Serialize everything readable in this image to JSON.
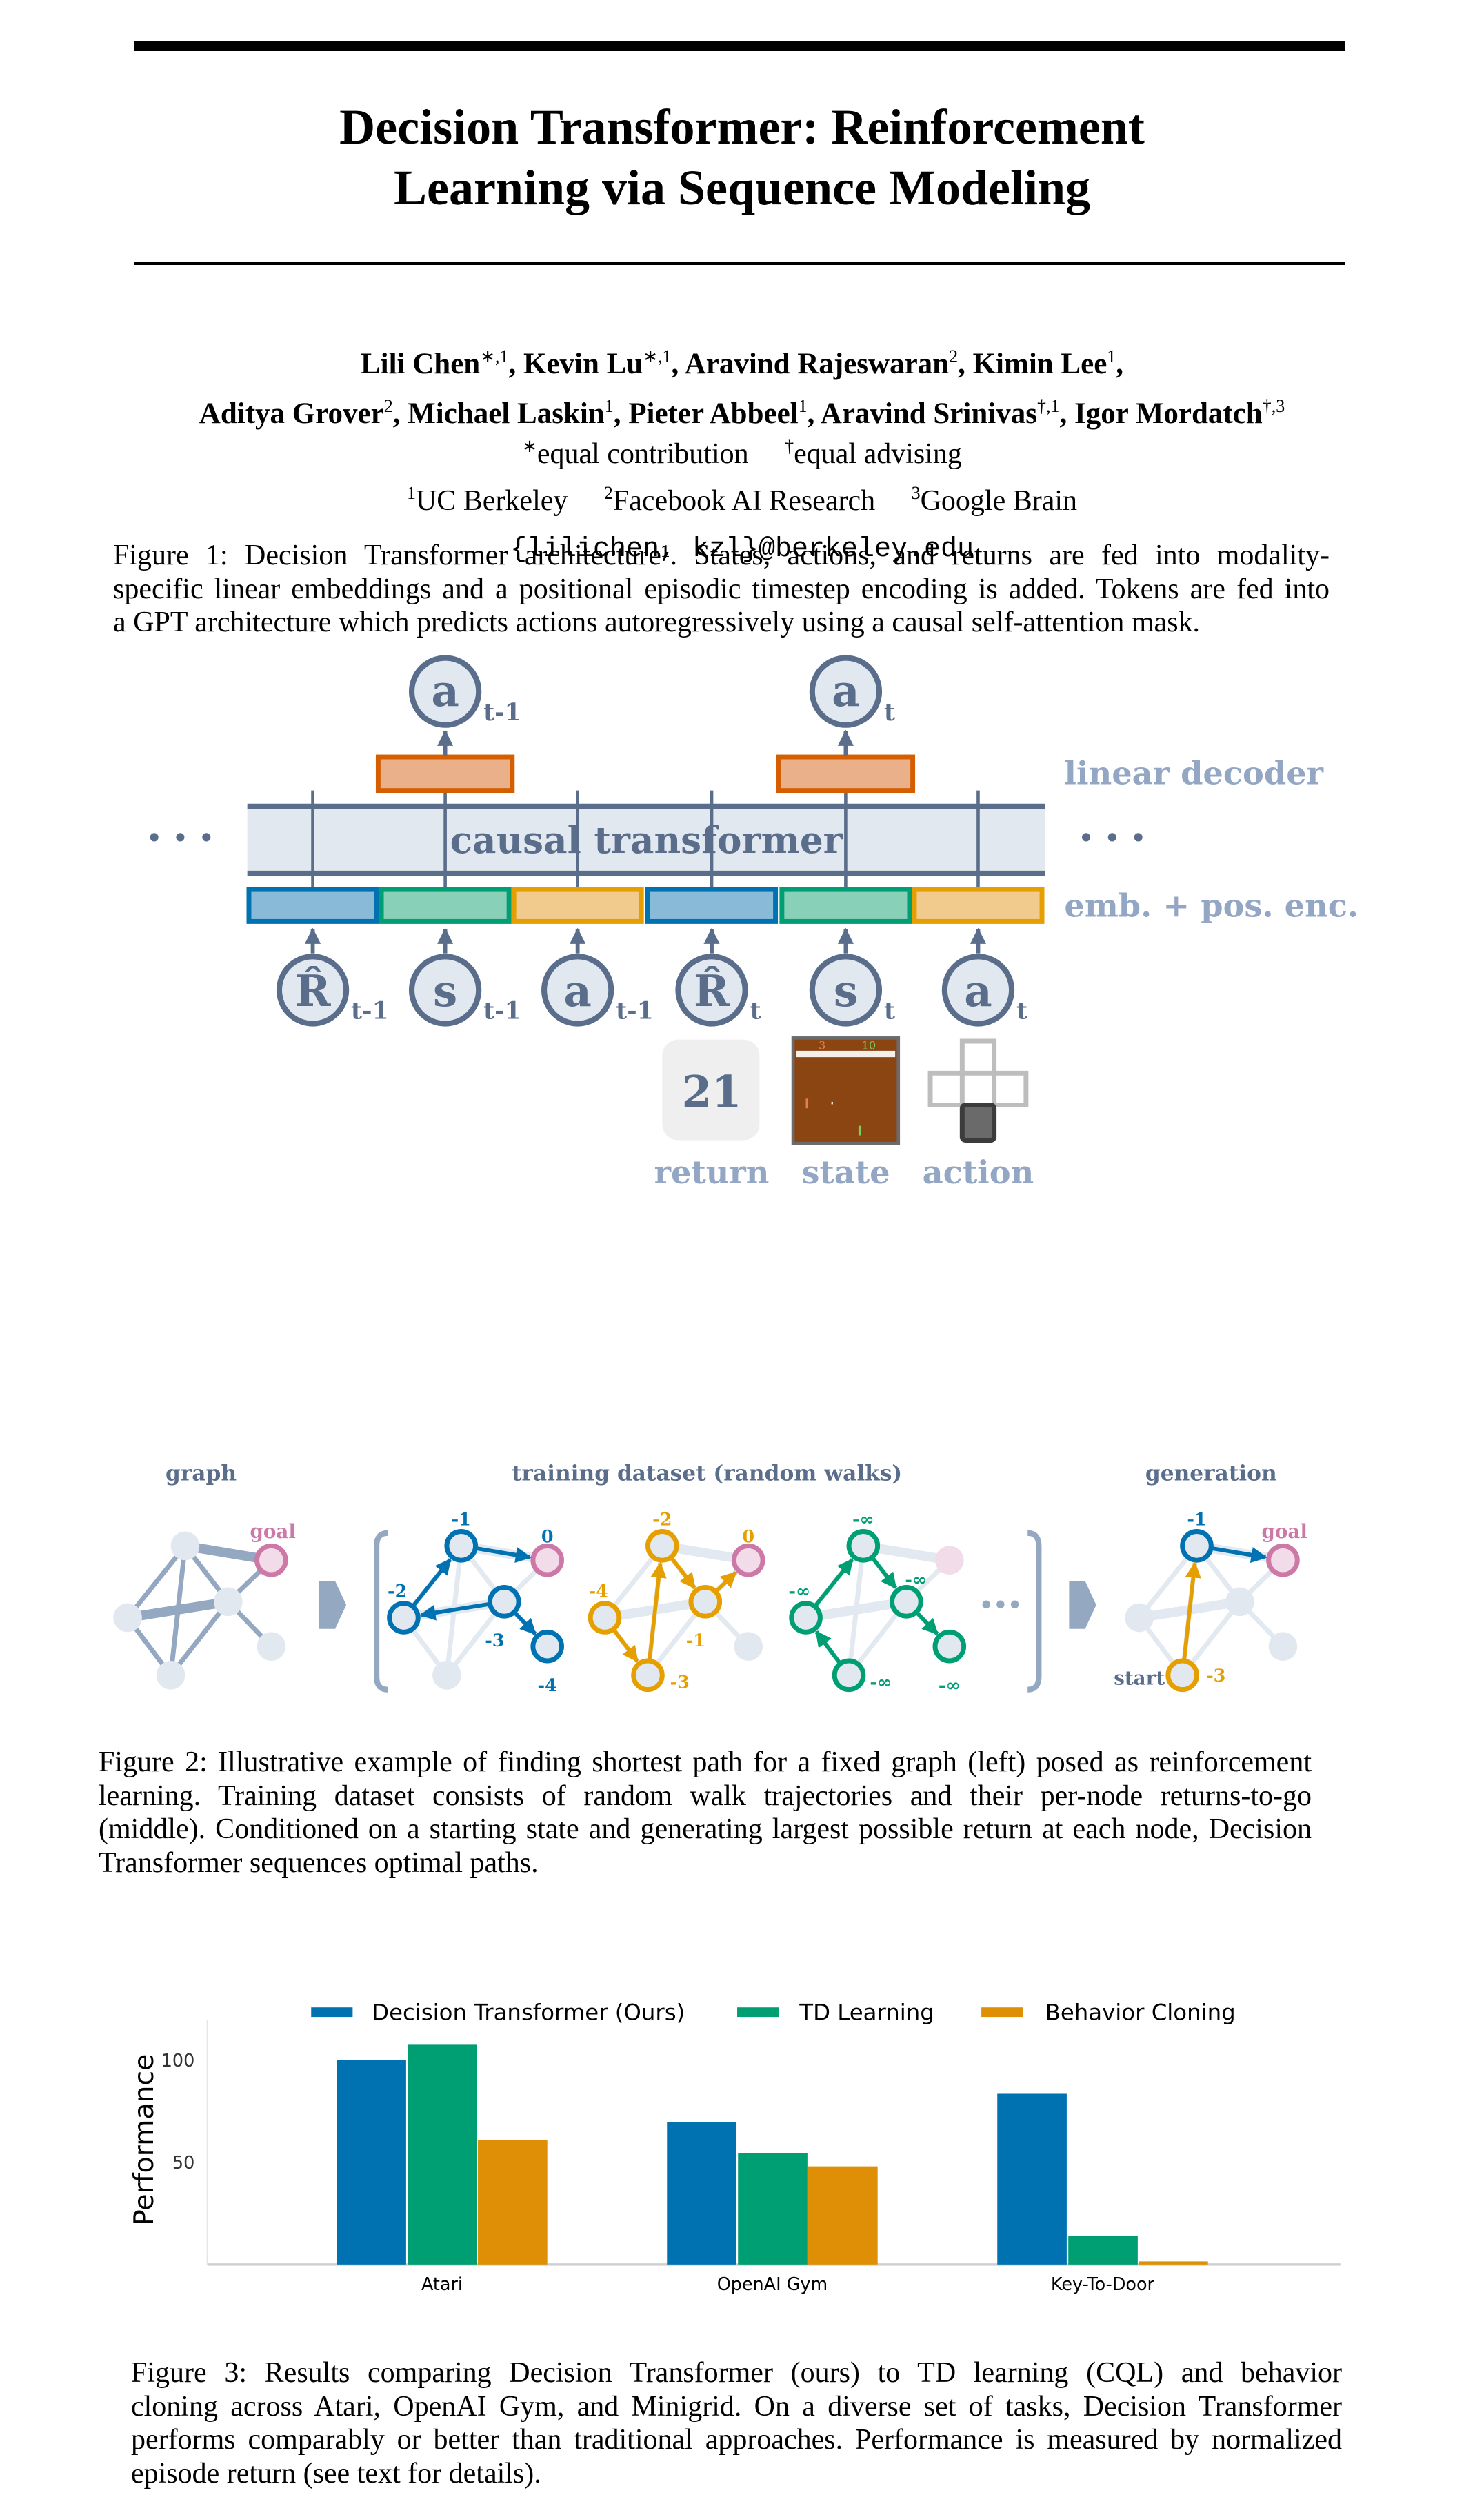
{
  "paper": {
    "title_lines": [
      "Decision Transformer: Reinforcement",
      "Learning via Sequence Modeling"
    ],
    "authors_line1": [
      {
        "name": "Lili Chen",
        "sup": "∗,1",
        "sep": ", "
      },
      {
        "name": "Kevin Lu",
        "sup": "∗,1",
        "sep": ", "
      },
      {
        "name": "Aravind Rajeswaran",
        "sup": "2",
        "sep": ", "
      },
      {
        "name": "Kimin Lee",
        "sup": "1",
        "sep": ","
      }
    ],
    "authors_line2": [
      {
        "name": "Aditya Grover",
        "sup": "2",
        "sep": ", "
      },
      {
        "name": "Michael Laskin",
        "sup": "1",
        "sep": ", "
      },
      {
        "name": "Pieter Abbeel",
        "sup": "1",
        "sep": ", "
      },
      {
        "name": "Aravind Srinivas",
        "sup": "†,1",
        "sep": ", "
      },
      {
        "name": "Igor Mordatch",
        "sup": "†,3",
        "sep": ""
      }
    ],
    "notes": [
      {
        "sup": "∗",
        "text": "equal contribution"
      },
      {
        "sup": "†",
        "text": "equal advising"
      }
    ],
    "affiliations": [
      {
        "sup": "1",
        "text": "UC Berkeley"
      },
      {
        "sup": "2",
        "text": "Facebook AI Research"
      },
      {
        "sup": "3",
        "text": "Google Brain"
      }
    ],
    "email": "{lilichen, kzl}@berkeley.edu"
  },
  "figure1": {
    "outputs": [
      {
        "sym": "a",
        "sub": "t-1"
      },
      {
        "sym": "a",
        "sub": "t"
      }
    ],
    "inputs": [
      {
        "sym": "R̂",
        "sub": "t-1"
      },
      {
        "sym": "s",
        "sub": "t-1"
      },
      {
        "sym": "a",
        "sub": "t-1"
      },
      {
        "sym": "R̂",
        "sub": "t"
      },
      {
        "sym": "s",
        "sub": "t"
      },
      {
        "sym": "a",
        "sub": "t"
      }
    ],
    "transformer_label": "causal transformer",
    "decoder_label": "linear decoder",
    "embedding_label": "emb. + pos. enc.",
    "ellipsis": "• • •",
    "return_value": "21",
    "state_score_left": "3",
    "state_score_right": "10",
    "modalities": [
      "return",
      "state",
      "action"
    ],
    "colors": {
      "return": "#0072b2",
      "state": "#009e73",
      "action": "#e69f00",
      "decoder": "#d55e00",
      "ink": "#5a6e8c",
      "label": "#93a7c4"
    },
    "caption": [
      "Figure 1:   Decision Transformer architecture¹. States, actions, and returns are fed into modality-",
      "specific linear embeddings and a positional episodic timestep encoding is added. Tokens are fed into",
      "a GPT architecture which predicts actions autoregressively using a causal self-attention mask."
    ]
  },
  "figure2": {
    "titles": {
      "graph": "graph",
      "training": "training dataset (random walks)",
      "generation": "generation"
    },
    "goal_label": "goal",
    "start_label": "start",
    "ellipsis": "•••",
    "colors": {
      "walk1": "#0072b2",
      "walk2": "#e69f00",
      "walk3": "#009e73",
      "goal": "#cc79a7",
      "graph": "#94a8c2"
    },
    "walks": [
      {
        "color": "#0072b2",
        "labels": {
          "top": "-1",
          "goal": "0",
          "left": "-2",
          "mid": "-3",
          "lowright": "-4"
        }
      },
      {
        "color": "#e69f00",
        "labels": {
          "top": "-2",
          "goal": "0",
          "left": "-4",
          "mid": "-1",
          "bottom": "-3"
        }
      },
      {
        "color": "#009e73",
        "labels": {
          "top": "-∞",
          "left": "-∞",
          "mid": "-∞",
          "lowright": "-∞",
          "bottom": "-∞"
        }
      }
    ],
    "generation": {
      "labels": {
        "top": "-1",
        "bottom": "-3"
      }
    },
    "caption": [
      "Figure 2:  Illustrative example of finding shortest path for a fixed graph (left) posed as reinforcement",
      "learning.  Training dataset consists of random walk trajectories and their per-node returns-to-go",
      "(middle). Conditioned on a starting state and generating largest possible return at each node, Decision",
      "Transformer sequences optimal paths."
    ]
  },
  "chart_data": {
    "type": "bar",
    "categories": [
      "Atari",
      "OpenAI Gym",
      "Key-To-Door"
    ],
    "series": [
      {
        "name": "Decision Transformer (Ours)",
        "color": "#0072b2",
        "values": [
          100,
          69.5,
          83.5
        ]
      },
      {
        "name": "TD Learning",
        "color": "#009e73",
        "values": [
          107.5,
          54.5,
          14
        ]
      },
      {
        "name": "Behavior Cloning",
        "color": "#de8f05",
        "values": [
          61,
          48,
          1.5
        ]
      }
    ],
    "title": "",
    "xlabel": "",
    "ylabel": "Performance",
    "ylim": [
      0,
      120
    ],
    "yticks": [
      "50",
      "100"
    ],
    "grid": false,
    "legend": "top"
  },
  "figure3": {
    "caption": [
      "Figure 3:   Results comparing Decision Transformer (ours) to TD learning (CQL) and behavior",
      "cloning across Atari, OpenAI Gym, and Minigrid. On a diverse set of tasks, Decision Transformer",
      "performs comparably or better than traditional approaches. Performance is measured by normalized",
      "episode return (see text for details)."
    ]
  }
}
